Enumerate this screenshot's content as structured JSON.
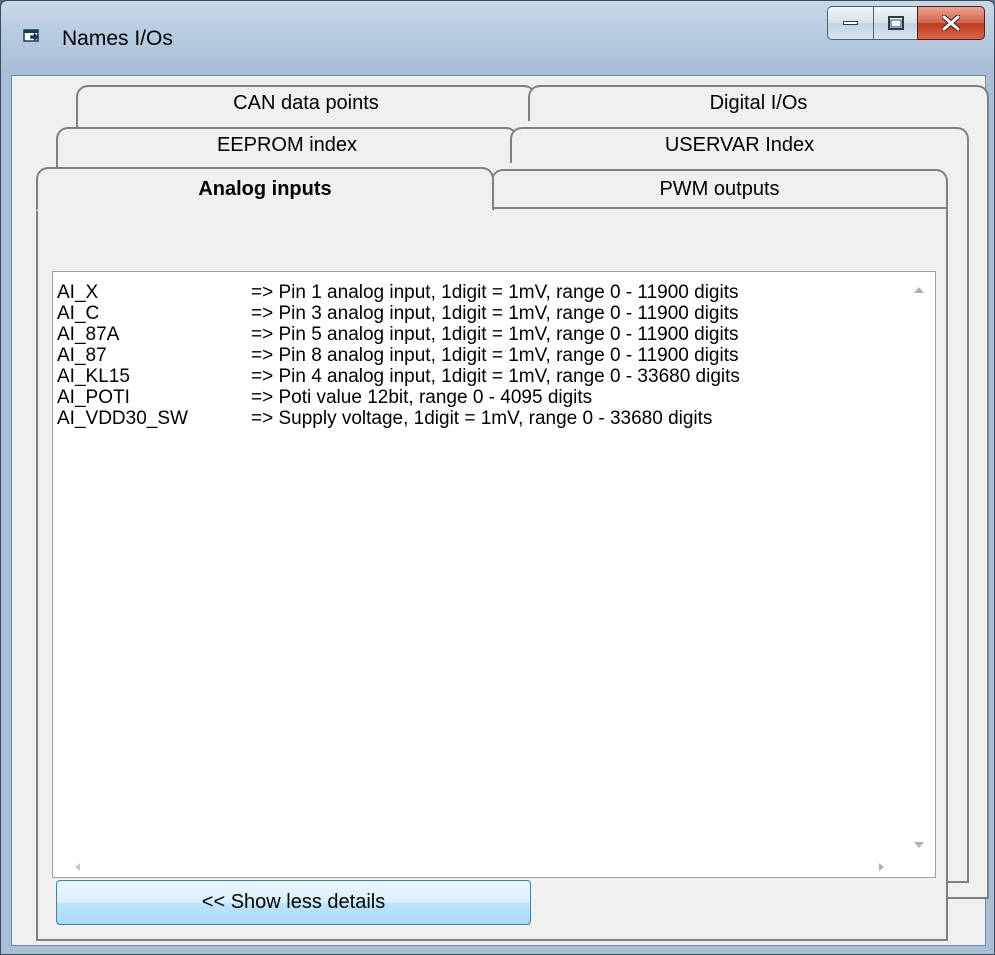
{
  "window": {
    "title": "Names I/Os",
    "icon": "window-icon",
    "controls": {
      "minimize_icon": "minimize-icon",
      "maximize_icon": "maximize-icon",
      "close_icon": "close-icon"
    }
  },
  "tabs": {
    "row1": [
      {
        "label": "CAN data points"
      },
      {
        "label": "Digital I/Os"
      }
    ],
    "row2": [
      {
        "label": "EEPROM index"
      },
      {
        "label": "USERVAR Index"
      }
    ],
    "row3": [
      {
        "label": "Analog inputs",
        "active": true
      },
      {
        "label": "PWM outputs"
      }
    ]
  },
  "list": {
    "items": [
      {
        "name": "AI_X",
        "desc": "=> Pin 1 analog input, 1digit = 1mV, range 0 - 11900 digits"
      },
      {
        "name": "AI_C",
        "desc": "=> Pin 3 analog input, 1digit = 1mV, range 0 - 11900 digits"
      },
      {
        "name": "AI_87A",
        "desc": "=> Pin 5 analog input, 1digit = 1mV, range 0 - 11900 digits"
      },
      {
        "name": "AI_87",
        "desc": "=> Pin 8 analog input, 1digit = 1mV, range 0 - 11900 digits"
      },
      {
        "name": "AI_KL15",
        "desc": "=> Pin 4 analog input, 1digit = 1mV, range 0 - 33680 digits"
      },
      {
        "name": "AI_POTI",
        "desc": "=> Poti value 12bit, range 0 - 4095 digits"
      },
      {
        "name": "AI_VDD30_SW",
        "desc": "=> Supply voltage, 1digit = 1mV, range 0 - 33680 digits"
      }
    ]
  },
  "footer": {
    "details_button_label": "<< Show less details"
  },
  "colors": {
    "accent": "#3c7fb1",
    "close_button": "#c0391f"
  }
}
